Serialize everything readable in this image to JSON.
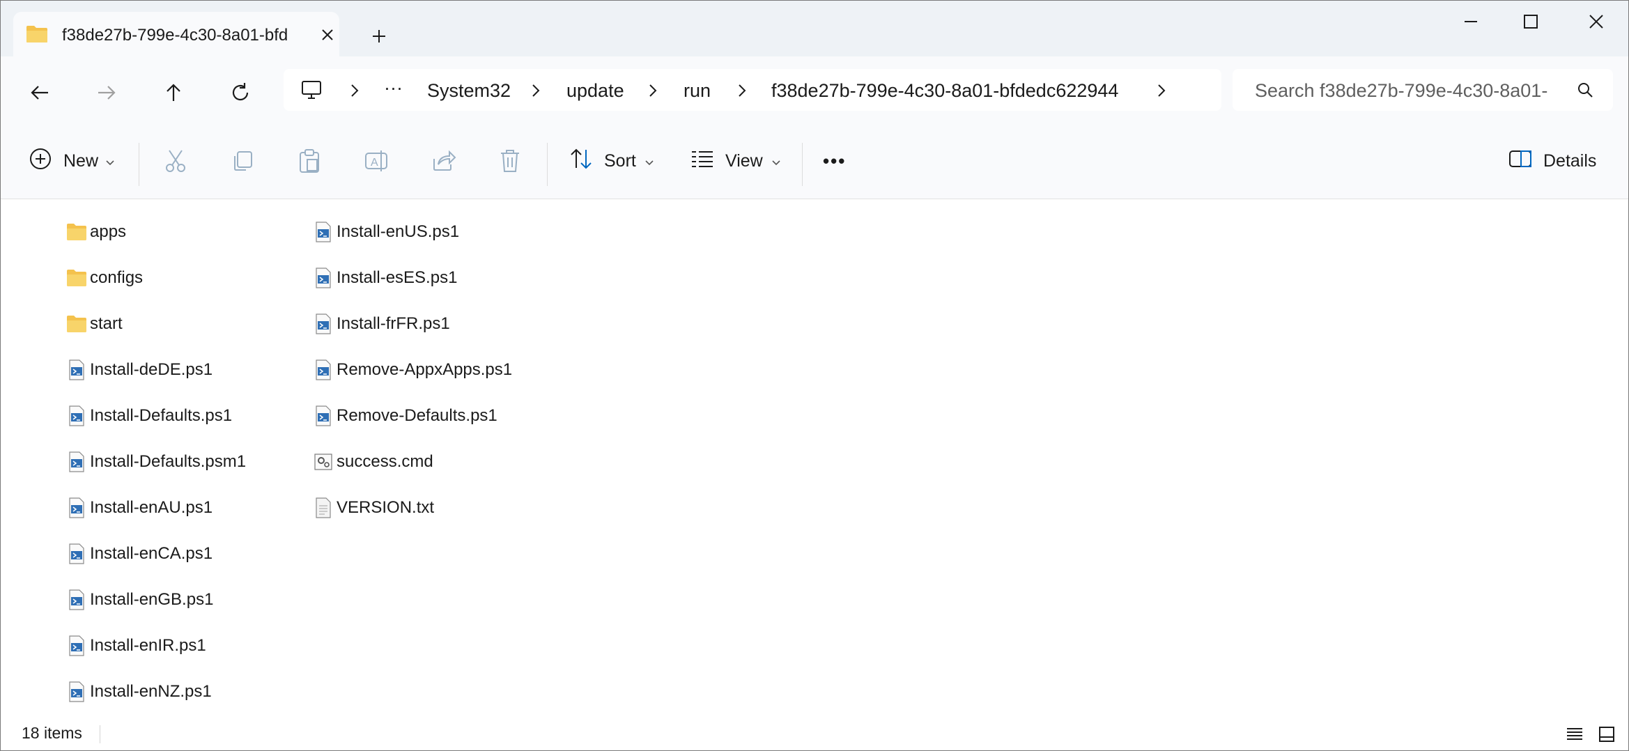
{
  "window": {
    "tab_title": "f38de27b-799e-4c30-8a01-bfd",
    "new_tab_label": "+"
  },
  "breadcrumb": {
    "items": [
      "System32",
      "update",
      "run",
      "f38de27b-799e-4c30-8a01-bfdedc622944"
    ],
    "overflow": "···"
  },
  "search": {
    "placeholder": "Search f38de27b-799e-4c30-8a01-"
  },
  "toolbar": {
    "new_label": "New",
    "sort_label": "Sort",
    "view_label": "View",
    "more_label": "•••",
    "details_label": "Details"
  },
  "files": {
    "column1": [
      {
        "name": "apps",
        "type": "folder"
      },
      {
        "name": "configs",
        "type": "folder"
      },
      {
        "name": "start",
        "type": "folder"
      },
      {
        "name": "Install-deDE.ps1",
        "type": "script"
      },
      {
        "name": "Install-Defaults.ps1",
        "type": "script"
      },
      {
        "name": "Install-Defaults.psm1",
        "type": "script"
      },
      {
        "name": "Install-enAU.ps1",
        "type": "script"
      },
      {
        "name": "Install-enCA.ps1",
        "type": "script"
      },
      {
        "name": "Install-enGB.ps1",
        "type": "script"
      },
      {
        "name": "Install-enIR.ps1",
        "type": "script"
      },
      {
        "name": "Install-enNZ.ps1",
        "type": "script"
      }
    ],
    "column2": [
      {
        "name": "Install-enUS.ps1",
        "type": "script"
      },
      {
        "name": "Install-esES.ps1",
        "type": "script"
      },
      {
        "name": "Install-frFR.ps1",
        "type": "script"
      },
      {
        "name": "Remove-AppxApps.ps1",
        "type": "script"
      },
      {
        "name": "Remove-Defaults.ps1",
        "type": "script"
      },
      {
        "name": "success.cmd",
        "type": "cmd"
      },
      {
        "name": "VERSION.txt",
        "type": "text"
      }
    ]
  },
  "status": {
    "item_count": "18 items"
  },
  "colors": {
    "folder": "#f4c24d",
    "accent": "#0067c0",
    "chrome": "#eef2f6"
  }
}
